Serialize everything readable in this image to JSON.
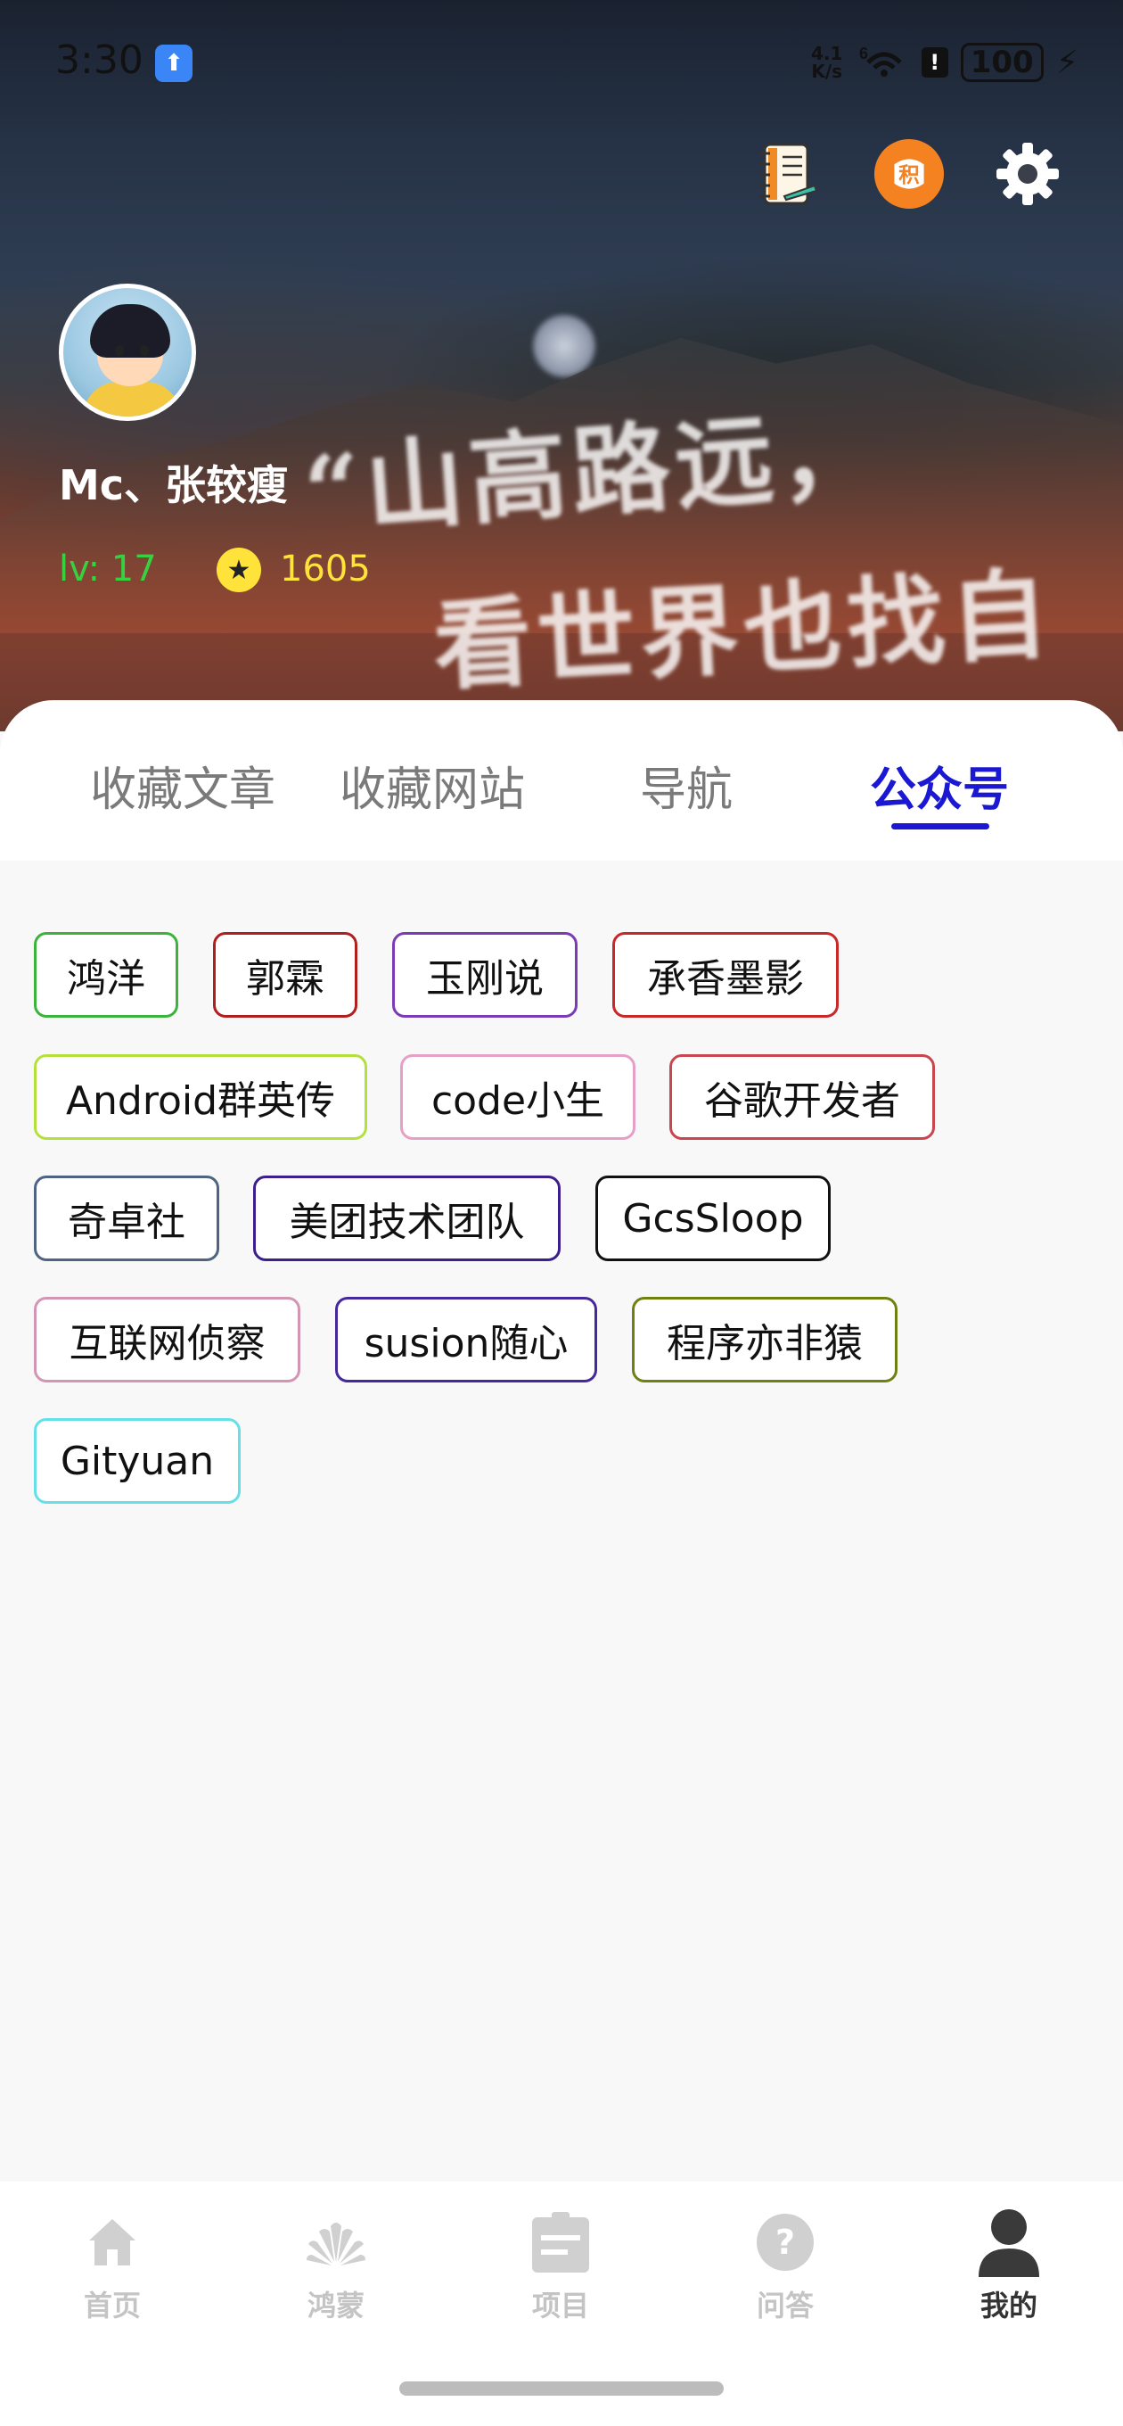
{
  "status_bar": {
    "time": "3:30",
    "network_speed": "4.1\nK/s",
    "signal": "6",
    "battery": "100",
    "charging_icon": "lightning-icon",
    "app_icon": "upload-arrow-icon"
  },
  "header": {
    "background_text_line1": "“山高路远，",
    "background_text_line2": "看世界也找自己。”",
    "actions": [
      {
        "name": "notebook-icon"
      },
      {
        "name": "points-icon",
        "label": "积"
      },
      {
        "name": "gear-icon"
      }
    ]
  },
  "profile": {
    "username": "Mc、张较瘦",
    "level_label": "lv:  17",
    "coin_icon": "star-coin-icon",
    "coins": "1605"
  },
  "tabs": [
    {
      "label": "收藏文章",
      "active": false
    },
    {
      "label": "收藏网站",
      "active": false
    },
    {
      "label": "导航",
      "active": false
    },
    {
      "label": "公众号",
      "active": true
    }
  ],
  "accent_color": "#1a18d2",
  "wechat_accounts": [
    {
      "label": "鸿洋",
      "color": "#3cb43c"
    },
    {
      "label": "郭霖",
      "color": "#b01e1e"
    },
    {
      "label": "玉刚说",
      "color": "#7a3cb4"
    },
    {
      "label": "承香墨影",
      "color": "#c82828"
    },
    {
      "label": "Android群英传",
      "color": "#b4e03c"
    },
    {
      "label": "code小生",
      "color": "#e6a0c8"
    },
    {
      "label": "谷歌开发者",
      "color": "#c84650"
    },
    {
      "label": "奇卓社",
      "color": "#506482"
    },
    {
      "label": "美团技术团队",
      "color": "#3c1e8c"
    },
    {
      "label": "GcsSloop",
      "color": "#111111"
    },
    {
      "label": "互联网侦察",
      "color": "#d296b4"
    },
    {
      "label": "susion随心",
      "color": "#46289a"
    },
    {
      "label": "程序亦非猿",
      "color": "#6e8214"
    },
    {
      "label": "Gityuan",
      "color": "#64e0e6"
    }
  ],
  "bottom_nav": [
    {
      "label": "首页",
      "icon": "home-icon",
      "active": false
    },
    {
      "label": "鸿蒙",
      "icon": "harmony-icon",
      "active": false
    },
    {
      "label": "项目",
      "icon": "project-icon",
      "active": false
    },
    {
      "label": "问答",
      "icon": "question-icon",
      "active": false
    },
    {
      "label": "我的",
      "icon": "person-icon",
      "active": true
    }
  ]
}
